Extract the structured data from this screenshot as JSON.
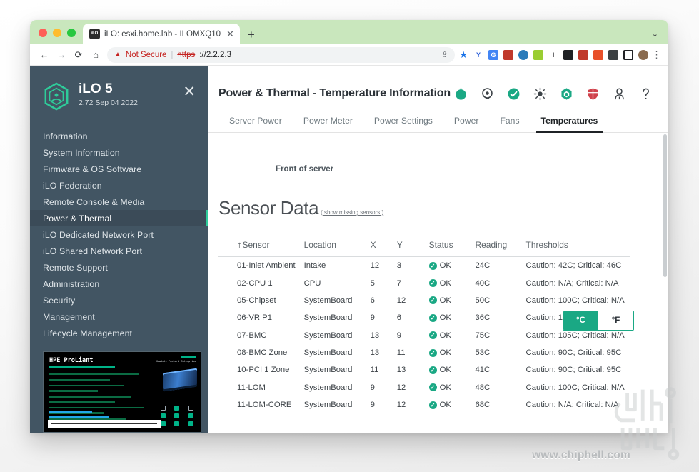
{
  "browser": {
    "tab": {
      "favicon_label": "iLO",
      "title": "iLO: esxi.home.lab - ILOMXQ10",
      "close_glyph": "✕"
    },
    "new_tab_glyph": "+",
    "tabstrip_chevron_glyph": "⌄",
    "nav": {
      "back_glyph": "←",
      "forward_glyph": "→",
      "reload_glyph": "⟳",
      "home_glyph": "⌂"
    },
    "omnibox": {
      "warning_glyph": "▲",
      "security_label": "Not Secure",
      "separator": "|",
      "url_scheme": "https",
      "url_rest": "://2.2.2.3",
      "share_glyph": "⇪",
      "bookmark_glyph": "★"
    },
    "extensions": [
      {
        "name": "yandex-extension-icon",
        "label": "Y",
        "color": "#ffffff",
        "text_color": "#2b5fd9"
      },
      {
        "name": "google-translate-icon",
        "label": "G",
        "color": "#4285f4",
        "text_color": "#ffffff"
      },
      {
        "name": "dictionary-extension-icon",
        "label": "",
        "color": "#c0392b",
        "text_color": "#ffffff"
      },
      {
        "name": "globe-extension-icon",
        "label": "",
        "color": "#2b7bba",
        "text_color": "#ffffff"
      },
      {
        "name": "notes-extension-icon",
        "label": "",
        "color": "#9acd32",
        "text_color": "#ffffff"
      },
      {
        "name": "italic-extension-icon",
        "label": "I",
        "color": "#ffffff",
        "text_color": "#202124"
      },
      {
        "name": "glasses-extension-icon",
        "label": "",
        "color": "#202124",
        "text_color": "#ffffff"
      },
      {
        "name": "ublock-origin-icon",
        "label": "",
        "color": "#c0392b",
        "text_color": "#ffffff"
      },
      {
        "name": "office-extension-icon",
        "label": "",
        "color": "#e8502a",
        "text_color": "#ffffff"
      },
      {
        "name": "puzzle-extensions-icon",
        "label": "",
        "color": "#3c4043",
        "text_color": "#ffffff"
      },
      {
        "name": "sidepanel-icon",
        "label": "",
        "color": "#ffffff",
        "text_color": "#202124"
      },
      {
        "name": "profile-avatar-icon",
        "label": "",
        "color": "#8a6b4f",
        "text_color": "#ffffff"
      }
    ],
    "menu_glyph": "⋮"
  },
  "sidebar": {
    "product_name": "iLO 5",
    "version": "2.72 Sep 04 2022",
    "close_glyph": "✕",
    "accent_color": "#2ecc9a",
    "background_color": "#425563",
    "items": [
      {
        "label": "Information",
        "active": false
      },
      {
        "label": "System Information",
        "active": false
      },
      {
        "label": "Firmware & OS Software",
        "active": false
      },
      {
        "label": "iLO Federation",
        "active": false
      },
      {
        "label": "Remote Console & Media",
        "active": false
      },
      {
        "label": "Power & Thermal",
        "active": true
      },
      {
        "label": "iLO Dedicated Network Port",
        "active": false
      },
      {
        "label": "iLO Shared Network Port",
        "active": false
      },
      {
        "label": "Remote Support",
        "active": false
      },
      {
        "label": "Administration",
        "active": false
      },
      {
        "label": "Security",
        "active": false
      },
      {
        "label": "Management",
        "active": false
      },
      {
        "label": "Lifecycle Management",
        "active": false
      }
    ],
    "post_preview": {
      "brand": "HPE ProLiant",
      "vendor": "Hewlett Packard Enterprise"
    }
  },
  "header": {
    "title": "Power & Thermal - Temperature Information",
    "icons": [
      {
        "name": "power-status-icon",
        "color": "#1aa884"
      },
      {
        "name": "uid-indicator-icon",
        "color": "#3c4247"
      },
      {
        "name": "health-ok-icon",
        "color": "#1aa884"
      },
      {
        "name": "brightness-icon",
        "color": "#3c4247"
      },
      {
        "name": "ilo-hexagon-icon",
        "color": "#1aa884"
      },
      {
        "name": "security-shield-icon",
        "color": "#d0414b"
      },
      {
        "name": "user-account-icon",
        "color": "#3c4247"
      },
      {
        "name": "help-icon",
        "color": "#3c4247"
      }
    ]
  },
  "tabs": [
    {
      "label": "Server Power",
      "active": false
    },
    {
      "label": "Power Meter",
      "active": false
    },
    {
      "label": "Power Settings",
      "active": false
    },
    {
      "label": "Power",
      "active": false
    },
    {
      "label": "Fans",
      "active": false
    },
    {
      "label": "Temperatures",
      "active": true
    }
  ],
  "diagram": {
    "caption": "Front of server"
  },
  "sensor_section": {
    "title": "Sensor Data",
    "show_missing_link": "( show missing sensors )",
    "unit_toggle": {
      "selected": "°C",
      "options": [
        "°C",
        "°F"
      ],
      "accent_color": "#1aa884"
    },
    "columns": [
      "Sensor",
      "Location",
      "X",
      "Y",
      "Status",
      "Reading",
      "Thresholds"
    ],
    "sort_column": "Sensor",
    "sort_arrow_glyph": "↑",
    "rows": [
      {
        "sensor": "01-Inlet Ambient",
        "location": "Intake",
        "x": "12",
        "y": "3",
        "status": "OK",
        "reading": "24C",
        "thresholds": "Caution: 42C; Critical: 46C"
      },
      {
        "sensor": "02-CPU 1",
        "location": "CPU",
        "x": "5",
        "y": "7",
        "status": "OK",
        "reading": "40C",
        "thresholds": "Caution: N/A; Critical: N/A"
      },
      {
        "sensor": "05-Chipset",
        "location": "SystemBoard",
        "x": "6",
        "y": "12",
        "status": "OK",
        "reading": "50C",
        "thresholds": "Caution: 100C; Critical: N/A"
      },
      {
        "sensor": "06-VR P1",
        "location": "SystemBoard",
        "x": "9",
        "y": "6",
        "status": "OK",
        "reading": "36C",
        "thresholds": "Caution: 115C; Critical: 120C"
      },
      {
        "sensor": "07-BMC",
        "location": "SystemBoard",
        "x": "13",
        "y": "9",
        "status": "OK",
        "reading": "75C",
        "thresholds": "Caution: 105C; Critical: N/A"
      },
      {
        "sensor": "08-BMC Zone",
        "location": "SystemBoard",
        "x": "13",
        "y": "11",
        "status": "OK",
        "reading": "53C",
        "thresholds": "Caution: 90C; Critical: 95C"
      },
      {
        "sensor": "10-PCI 1 Zone",
        "location": "SystemBoard",
        "x": "11",
        "y": "13",
        "status": "OK",
        "reading": "41C",
        "thresholds": "Caution: 90C; Critical: 95C"
      },
      {
        "sensor": "11-LOM",
        "location": "SystemBoard",
        "x": "9",
        "y": "12",
        "status": "OK",
        "reading": "48C",
        "thresholds": "Caution: 100C; Critical: N/A"
      },
      {
        "sensor": "11-LOM-CORE",
        "location": "SystemBoard",
        "x": "9",
        "y": "12",
        "status": "OK",
        "reading": "68C",
        "thresholds": "Caution: N/A; Critical: N/A"
      }
    ]
  },
  "watermark": {
    "text": "www.chiphell.com"
  }
}
